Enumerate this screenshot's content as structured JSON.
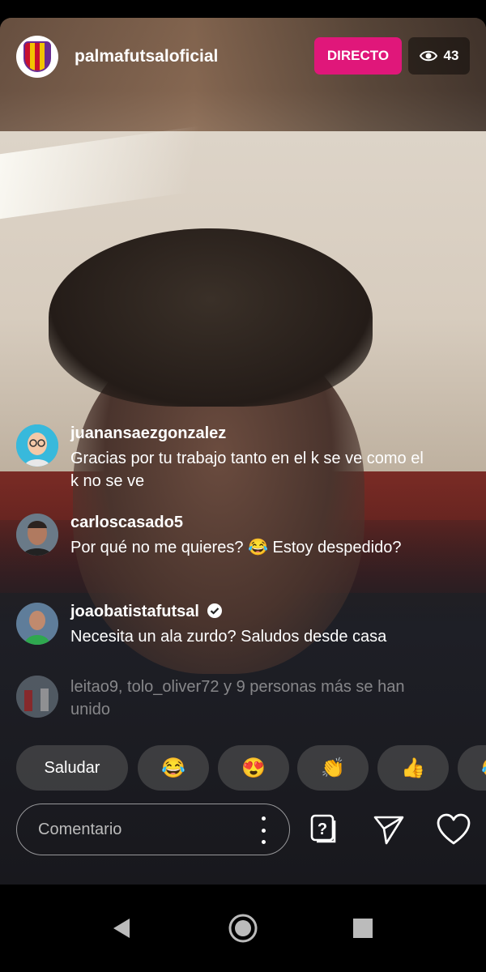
{
  "header": {
    "username": "palmafutsaloficial",
    "live_label": "DIRECTO",
    "viewer_count": "43",
    "eye_icon": "eye-icon"
  },
  "comments": [
    {
      "user": "juanansaezgonzalez",
      "text": "Gracias por tu trabajo tanto en el k se ve como el k no se ve"
    },
    {
      "user": "carloscasado5",
      "text": "Por qué  no me quieres? 😂 Estoy despedido?"
    },
    {
      "user": "joaobatistafutsal",
      "text": "Necesita un ala zurdo? Saludos desde casa",
      "verified": true
    }
  ],
  "joined_notice": "leitao9, tolo_oliver72 y 9 personas más se han unido",
  "quick_reactions": [
    "Saludar",
    "😂",
    "😍",
    "👏",
    "👍",
    "😂"
  ],
  "comment_input": {
    "placeholder": "Comentario"
  },
  "colors": {
    "live": "#e0177a",
    "chip": "rgba(90,90,90,0.55)"
  }
}
